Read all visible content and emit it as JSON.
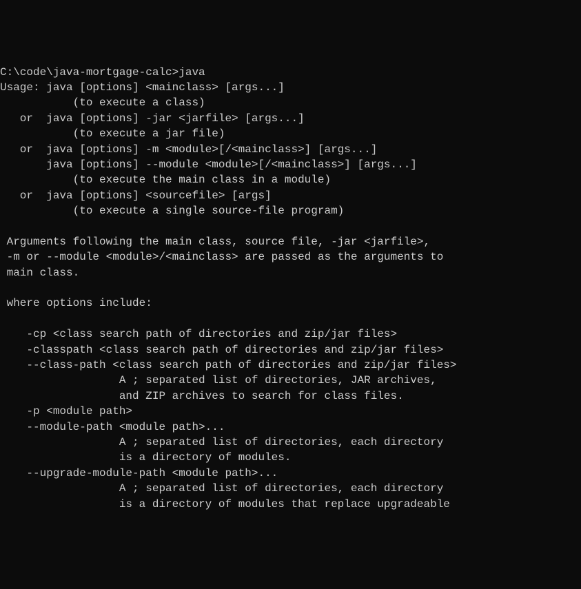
{
  "prompt": "C:\\code\\java-mortgage-calc>java",
  "lines": [
    "Usage: java [options] <mainclass> [args...]",
    "           (to execute a class)",
    "   or  java [options] -jar <jarfile> [args...]",
    "           (to execute a jar file)",
    "   or  java [options] -m <module>[/<mainclass>] [args...]",
    "       java [options] --module <module>[/<mainclass>] [args...]",
    "           (to execute the main class in a module)",
    "   or  java [options] <sourcefile> [args]",
    "           (to execute a single source-file program)",
    "",
    " Arguments following the main class, source file, -jar <jarfile>,",
    " -m or --module <module>/<mainclass> are passed as the arguments to",
    " main class.",
    "",
    " where options include:",
    "",
    "    -cp <class search path of directories and zip/jar files>",
    "    -classpath <class search path of directories and zip/jar files>",
    "    --class-path <class search path of directories and zip/jar files>",
    "                  A ; separated list of directories, JAR archives,",
    "                  and ZIP archives to search for class files.",
    "    -p <module path>",
    "    --module-path <module path>...",
    "                  A ; separated list of directories, each directory",
    "                  is a directory of modules.",
    "    --upgrade-module-path <module path>...",
    "                  A ; separated list of directories, each directory",
    "                  is a directory of modules that replace upgradeable"
  ]
}
